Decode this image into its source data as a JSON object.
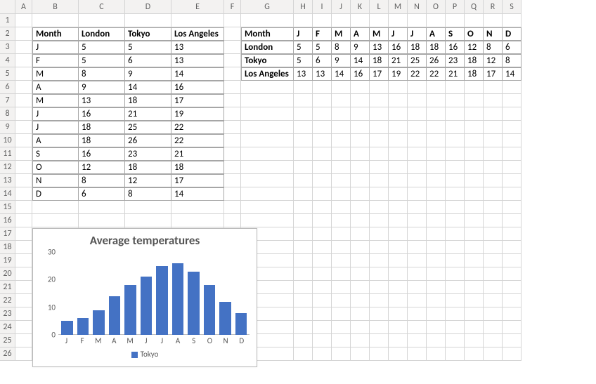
{
  "columns": {
    "labels": [
      "A",
      "B",
      "C",
      "D",
      "E",
      "F",
      "G",
      "H",
      "I",
      "J",
      "K",
      "L",
      "M",
      "N",
      "O",
      "P",
      "Q",
      "R",
      "S"
    ],
    "widths": [
      24,
      66,
      66,
      66,
      75,
      24,
      75,
      27,
      27,
      27,
      27,
      27,
      27,
      27,
      27,
      27,
      27,
      27,
      27
    ],
    "rowhdr_width": 22
  },
  "row_count": 26,
  "table1": {
    "start_col": 1,
    "start_row": 2,
    "headers": [
      "Month",
      "London",
      "Tokyo",
      "Los Angeles"
    ],
    "rows": [
      [
        "J",
        "5",
        "5",
        "13"
      ],
      [
        "F",
        "5",
        "6",
        "13"
      ],
      [
        "M",
        "8",
        "9",
        "14"
      ],
      [
        "A",
        "9",
        "14",
        "16"
      ],
      [
        "M",
        "13",
        "18",
        "17"
      ],
      [
        "J",
        "16",
        "21",
        "19"
      ],
      [
        "J",
        "18",
        "25",
        "22"
      ],
      [
        "A",
        "18",
        "26",
        "22"
      ],
      [
        "S",
        "16",
        "23",
        "21"
      ],
      [
        "O",
        "12",
        "18",
        "18"
      ],
      [
        "N",
        "8",
        "12",
        "17"
      ],
      [
        "D",
        "6",
        "8",
        "14"
      ]
    ]
  },
  "table2": {
    "start_col": 6,
    "start_row": 2,
    "headers": [
      "Month",
      "J",
      "F",
      "M",
      "A",
      "M",
      "J",
      "J",
      "A",
      "S",
      "O",
      "N",
      "D"
    ],
    "rows": [
      [
        "London",
        "5",
        "5",
        "8",
        "9",
        "13",
        "16",
        "18",
        "18",
        "16",
        "12",
        "8",
        "6"
      ],
      [
        "Tokyo",
        "5",
        "6",
        "9",
        "14",
        "18",
        "21",
        "25",
        "26",
        "23",
        "18",
        "12",
        "8"
      ],
      [
        "Los Angeles",
        "13",
        "13",
        "14",
        "16",
        "17",
        "19",
        "22",
        "22",
        "21",
        "18",
        "17",
        "14"
      ]
    ]
  },
  "chart_data": {
    "type": "bar",
    "title": "Average temperatures",
    "series": [
      {
        "name": "Tokyo",
        "values": [
          5,
          6,
          9,
          14,
          18,
          21,
          25,
          26,
          23,
          18,
          12,
          8
        ]
      }
    ],
    "categories": [
      "J",
      "F",
      "M",
      "A",
      "M",
      "J",
      "J",
      "A",
      "S",
      "O",
      "N",
      "D"
    ],
    "ylim": [
      0,
      30
    ],
    "yticks": [
      0,
      10,
      20,
      30
    ],
    "bar_color": "#4472c4"
  },
  "legend_label": "Tokyo"
}
